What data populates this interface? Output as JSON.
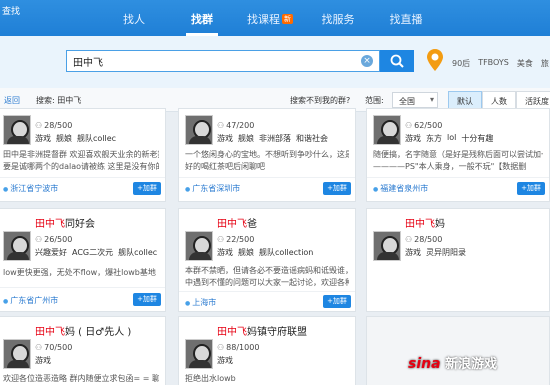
{
  "app": {
    "title": "查找"
  },
  "nav": [
    {
      "label": "找人",
      "active": false
    },
    {
      "label": "找群",
      "active": true
    },
    {
      "label": "找课程",
      "active": false,
      "badge": "新"
    },
    {
      "label": "找服务",
      "active": false
    },
    {
      "label": "找直播",
      "active": false
    }
  ],
  "search": {
    "value": "田中飞",
    "clear_icon": "×"
  },
  "hot_links": [
    "90后",
    "TFBOYS",
    "美食",
    "旅"
  ],
  "filter": {
    "back": "返回",
    "search_label": "搜索: 田中飞",
    "not_found": "搜索不到我的群?",
    "range_label": "范围:",
    "range_value": "全国",
    "sort_tabs": [
      "默认",
      "人数",
      "活跃度"
    ]
  },
  "cards": [
    {
      "name_hl": "",
      "name_rest": "",
      "members": "28/500",
      "tags": [
        "游戏",
        "舰娘",
        "舰队collec"
      ],
      "desc": "田中是非洲提督群 欢迎喜欢舰天业余的新老提督",
      "desc2": "要是诚哪两个的dalao请被练 这里是没有你的位置",
      "location": "浙江省宁波市",
      "join": "+加群"
    },
    {
      "name_hl": "",
      "name_rest": "",
      "members": "47/200",
      "tags": [
        "游戏",
        "舰娘",
        "非洲部落",
        "和谐社会"
      ],
      "desc": "一个悠闲身心的宝地。不想听到争吵什么，这是好",
      "desc2": "好的喝红茶吧后闲聊吧",
      "location": "广东省深圳市",
      "join": "+加群"
    },
    {
      "name_hl": "",
      "name_rest": "",
      "members": "62/500",
      "tags": [
        "游戏",
        "东方",
        "lol",
        "十分有趣"
      ],
      "desc": "随便搞，名字随意（是好是残称后面可以尝试加一个）",
      "desc2": "————PS\"本人乘身，一般不玩\"【数据删",
      "location": "福建省泉州市",
      "join": "+加群"
    },
    {
      "name_hl": "田中飞",
      "name_rest": "同好会",
      "members": "26/500",
      "tags": [
        "兴趣爱好",
        "ACG二次元",
        "舰队collec"
      ],
      "desc": "low更快更强，无处不flow，爆社lowb基地",
      "desc2": "",
      "location": "广东省广州市",
      "join": "+加群"
    },
    {
      "name_hl": "田中飞",
      "name_rest": "爸",
      "members": "22/500",
      "tags": [
        "游戏",
        "舰娘",
        "舰队collection"
      ],
      "desc": "本群不禁晒，但请各必不要造谣病蚂和诋毁谁，游戏",
      "desc2": "中遇到不懂的问题可以大家一起讨论，欢迎各种",
      "location": "上海市",
      "join": "+加群"
    },
    {
      "name_hl": "田中飞",
      "name_rest": "妈",
      "members": "28/500",
      "tags": [
        "游戏",
        "灵异阴阳录"
      ],
      "desc": "",
      "desc2": "",
      "location": "",
      "join": ""
    },
    {
      "name_hl": "田中飞",
      "name_rest": "妈 ( 日♂先人 )",
      "members": "70/500",
      "tags": [
        "游戏"
      ],
      "desc": "欢迎各位造恶造略 群内随便立求包函= = 聊鹅N程N都",
      "desc2": "",
      "location": "",
      "join": ""
    },
    {
      "name_hl": "田中飞",
      "name_rest": "妈镇守府联盟",
      "members": "88/1000",
      "tags": [
        "游戏"
      ],
      "desc": "拒绝出水lowb",
      "desc2": "",
      "location": "",
      "join": ""
    }
  ],
  "watermark": {
    "logo": "sina",
    "text": "新浪游戏"
  }
}
